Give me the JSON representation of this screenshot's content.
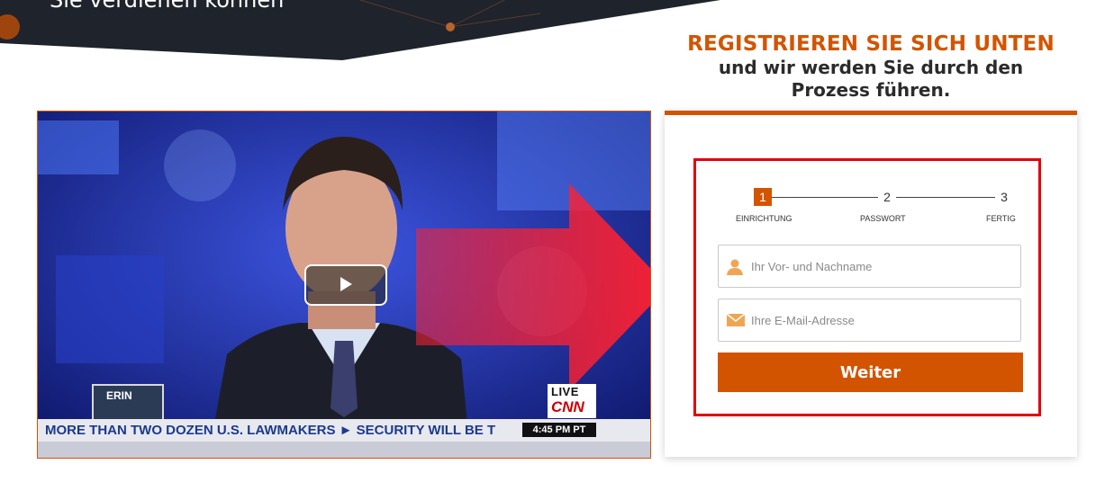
{
  "hero": {
    "text": "Sie verdienen können"
  },
  "heading": {
    "line1": "REGISTRIEREN SIE SICH UNTEN",
    "line2": "und wir werden Sie durch den",
    "line3": "Prozess führen."
  },
  "video": {
    "ticker": "MORE THAN TWO DOZEN U.S. LAWMAKERS  ►  SECURITY WILL BE T",
    "time": "4:45 PM PT",
    "live": "LIVE",
    "network": "CNN",
    "show": "ERIN"
  },
  "steps": [
    {
      "number": "1",
      "label": "EINRICHTUNG"
    },
    {
      "number": "2",
      "label": "PASSWORT"
    },
    {
      "number": "3",
      "label": "FERTIG"
    }
  ],
  "form": {
    "name_placeholder": "Ihr Vor- und Nachname",
    "email_placeholder": "Ihre E-Mail-Adresse",
    "submit_label": "Weiter"
  },
  "colors": {
    "accent": "#d35400",
    "frame": "#e3000f",
    "hero_bg": "#1e232c"
  },
  "icons": {
    "name": "user-icon",
    "email": "envelope-icon",
    "video": "play-icon"
  }
}
